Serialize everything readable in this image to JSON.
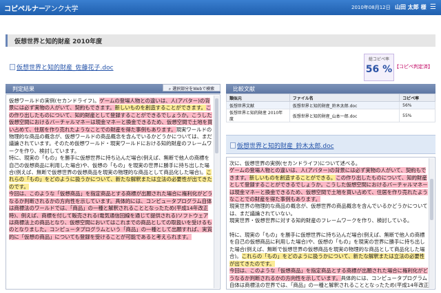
{
  "header": {
    "logo": "コピペルナー",
    "university": "アンク大学",
    "date": "2010年08月12日",
    "user": "山田 太郎 様",
    "menu_icon": "hamburger-icon"
  },
  "report": {
    "title": "仮想世界と知的財産 2010年度",
    "file_name": "仮想世界と知的財産_佐藤花子.doc"
  },
  "copy_rate": {
    "label": "総コピペ率",
    "value": "56 %",
    "judge_link": "【コピペ判定済】"
  },
  "left_panel": {
    "title": "判定結果",
    "web_button": "選択部分をWebで検索"
  },
  "right_panel": {
    "title": "比較文献",
    "table": {
      "headers": [
        "類似元",
        "ファイル名",
        "コピペ率"
      ],
      "rows": [
        [
          "仮想世界文献",
          "仮想世界と知的財産_鈴木太郎.doc",
          "56%"
        ],
        [
          "仮想世界と知的財産 2010年度",
          "仮想世界と知的財産_山本一郎.doc",
          "55%"
        ]
      ]
    },
    "source_link": "仮想世界と知的財産_鈴木太郎.doc"
  },
  "left_text": {
    "p1_a": "仮想ワールドの実例(セカンドライフ)。",
    "p1_b": "ゲームの登場人物との違いは、人(アバター)の背景には必ず実物の人がいて、契約もできます。",
    "p1_c": "新しいものを創造することができます。",
    "p1_d": "この作り出したものについて、知的財産として登録することができるでしょうか。",
    "p1_e": "こうした仮想空間におけるバーチャルマネーは現金マネーと換金できるため、仮想空間で土地を買い占めて、住居を作り売れたようなことでの財産を得た事例もあります。",
    "p1_f": "現実ワールドの物理的な商品の概念が、仮想ワールドの商品概念を含んでいるかどうかについては、まだ議論されています。",
    "p1_g": "そのため仮想ワールド・現実ワールドにおける知的財産のフレームワークを作り、検討しています。",
    "p2_a": "特に、現実の「もの」を勝手に仮想世界に持ち込んだ場合(例えば、無断で他人の商標を自己の仮想商品に利用した場合)や、仮想の「もの」を現実の世界に勝手に持ち出した場合(例えば、無断で仮想世界の仮想商品を現実の物理的な商品として商品化した場合)。",
    "p2_b": "これらの「もの」をどのように扱うかについて、新たな解釈または立法の必要性が出てきたのです。",
    "p3_a": "今回は、このような「仮想商品」を指定商品とする商標が出願された場合に権利化がどうなるか判断されるかの方向性を示しています。",
    "p3_b": "具体的には、コンピュータプログラム自体は商標法のワールドでは、「商品」の一種と解釈されることとなったため(平成14年改正時)、例えば、商標を付して販売される(電気通信回線を通じて提供される)ソフトウェアは商標法上の商品となり、仮想空間においてはこれまでの商品としての取扱いを受けるものとなりました。",
    "p3_c": "コンピュータプログラムという「商品」の一種として出願すれば、実質的に「仮想の商品」についても登録を受けることが可能であると考えられます。"
  },
  "right_text": {
    "p1_a": "次に、仮想世界の実例(セカンドライフ)について述べる。",
    "p1_b": "ゲームの登場人物との違いは、人(アバター)の背景には必ず実物の人がいて、契約もできます。",
    "p1_c": "新しいものを創造することができる。",
    "p1_d": "この作り出したものについて、知的財産として登録することができるでしょうか。",
    "p1_e": "こうした仮想空間におけるバーチャルマネーは現金マネーと換金できるため、仮想空間で土地を買い占めて、住居を作り売れたようなことでの財産を得た事例もあります。",
    "p1_f": "現実世界の物理的な商品の概念が、仮想世界の商品概念を含んでいるかどうかについては、まだ議論されていない。",
    "p1_g": "現実世界・仮想世界に対する知的財産のフレームワークを作り、検討している。",
    "p2_a": "特に、現実の「もの」を勝手に仮想世界に持ち込んだ場合(例えば、無断で他人の商標を自己の仮想商品に利用した場合)や、仮想の「もの」を現実の世界に勝手に持ち出した場合(例えば、無断で仮想世界の仮想商品を現実の物理的な商品として商品化した場合)。",
    "p2_b": "これらの「もの」をどのように扱うかについて、新たな解釈または立法の必要性が出てきたのです。",
    "p3_a": "今回は、このような「仮想商品」を指定商品とする商標が出願された場合に権利化がどうなるか判断されるかの方向性を示しています。",
    "p3_b": "具体的には、コンピュータプログラム自体は商標法の世界では、「商品」の一種と解釈されることとなったため(平成14年改正時)、例えば"
  }
}
